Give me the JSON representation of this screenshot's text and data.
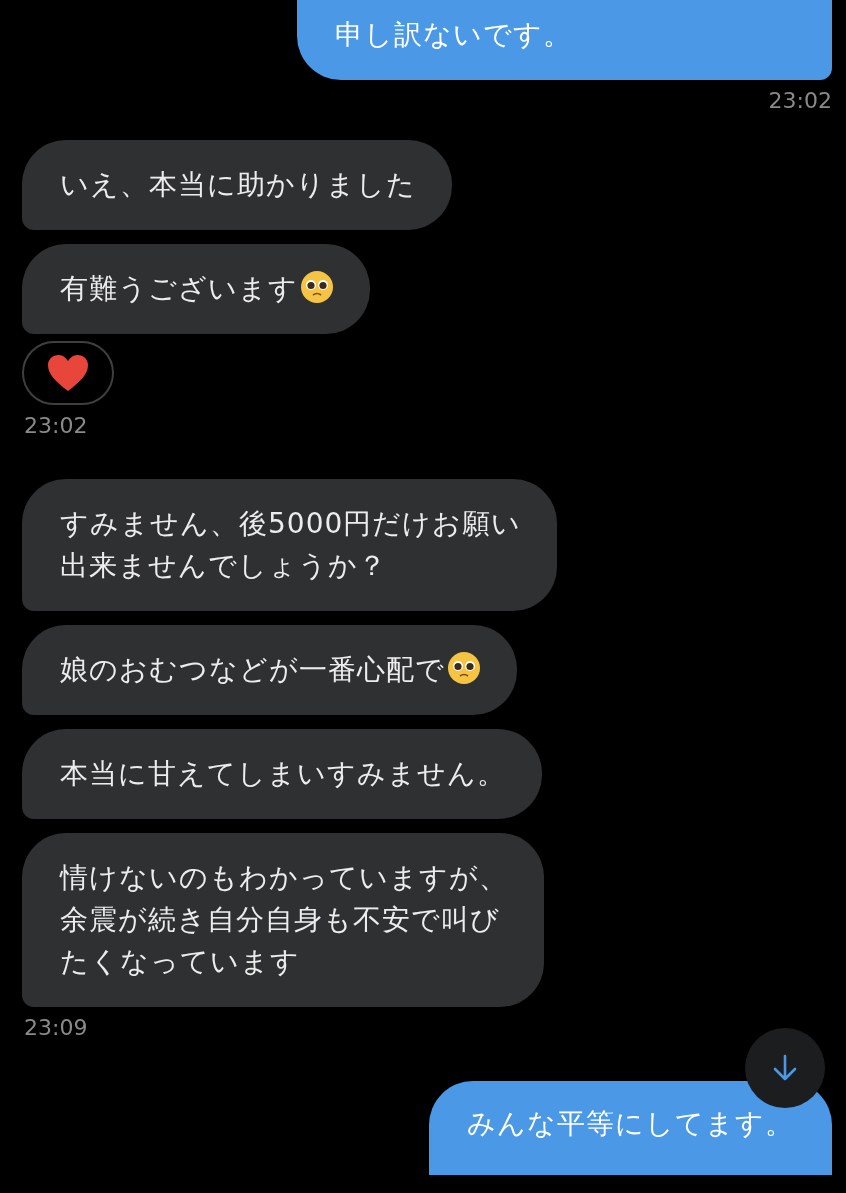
{
  "messages": [
    {
      "kind": "sent",
      "lines": [
        "申し訳ないです。"
      ],
      "emoji": false
    },
    {
      "kind": "sent_time",
      "text": "23:02"
    },
    {
      "kind": "received",
      "lines": [
        "いえ、本当に助かりました"
      ],
      "emoji": false
    },
    {
      "kind": "received",
      "lines": [
        "有難うございます"
      ],
      "emoji": true
    },
    {
      "kind": "reaction"
    },
    {
      "kind": "received_time",
      "text": "23:02"
    },
    {
      "kind": "received",
      "lines": [
        "すみません、後5000円だけお願い",
        "出来ませんでしょうか？"
      ],
      "emoji": false
    },
    {
      "kind": "received",
      "lines": [
        "娘のおむつなどが一番心配で"
      ],
      "emoji": true
    },
    {
      "kind": "received",
      "lines": [
        "本当に甘えてしまいすみません。"
      ],
      "emoji": false
    },
    {
      "kind": "received",
      "lines": [
        "情けないのもわかっていますが、",
        "余震が続き自分自身も不安で叫び",
        "たくなっています"
      ],
      "emoji": false
    },
    {
      "kind": "received_time",
      "text": "23:09"
    },
    {
      "kind": "sent",
      "lines": [
        "みんな平等にしてます。"
      ],
      "emoji": false
    }
  ]
}
